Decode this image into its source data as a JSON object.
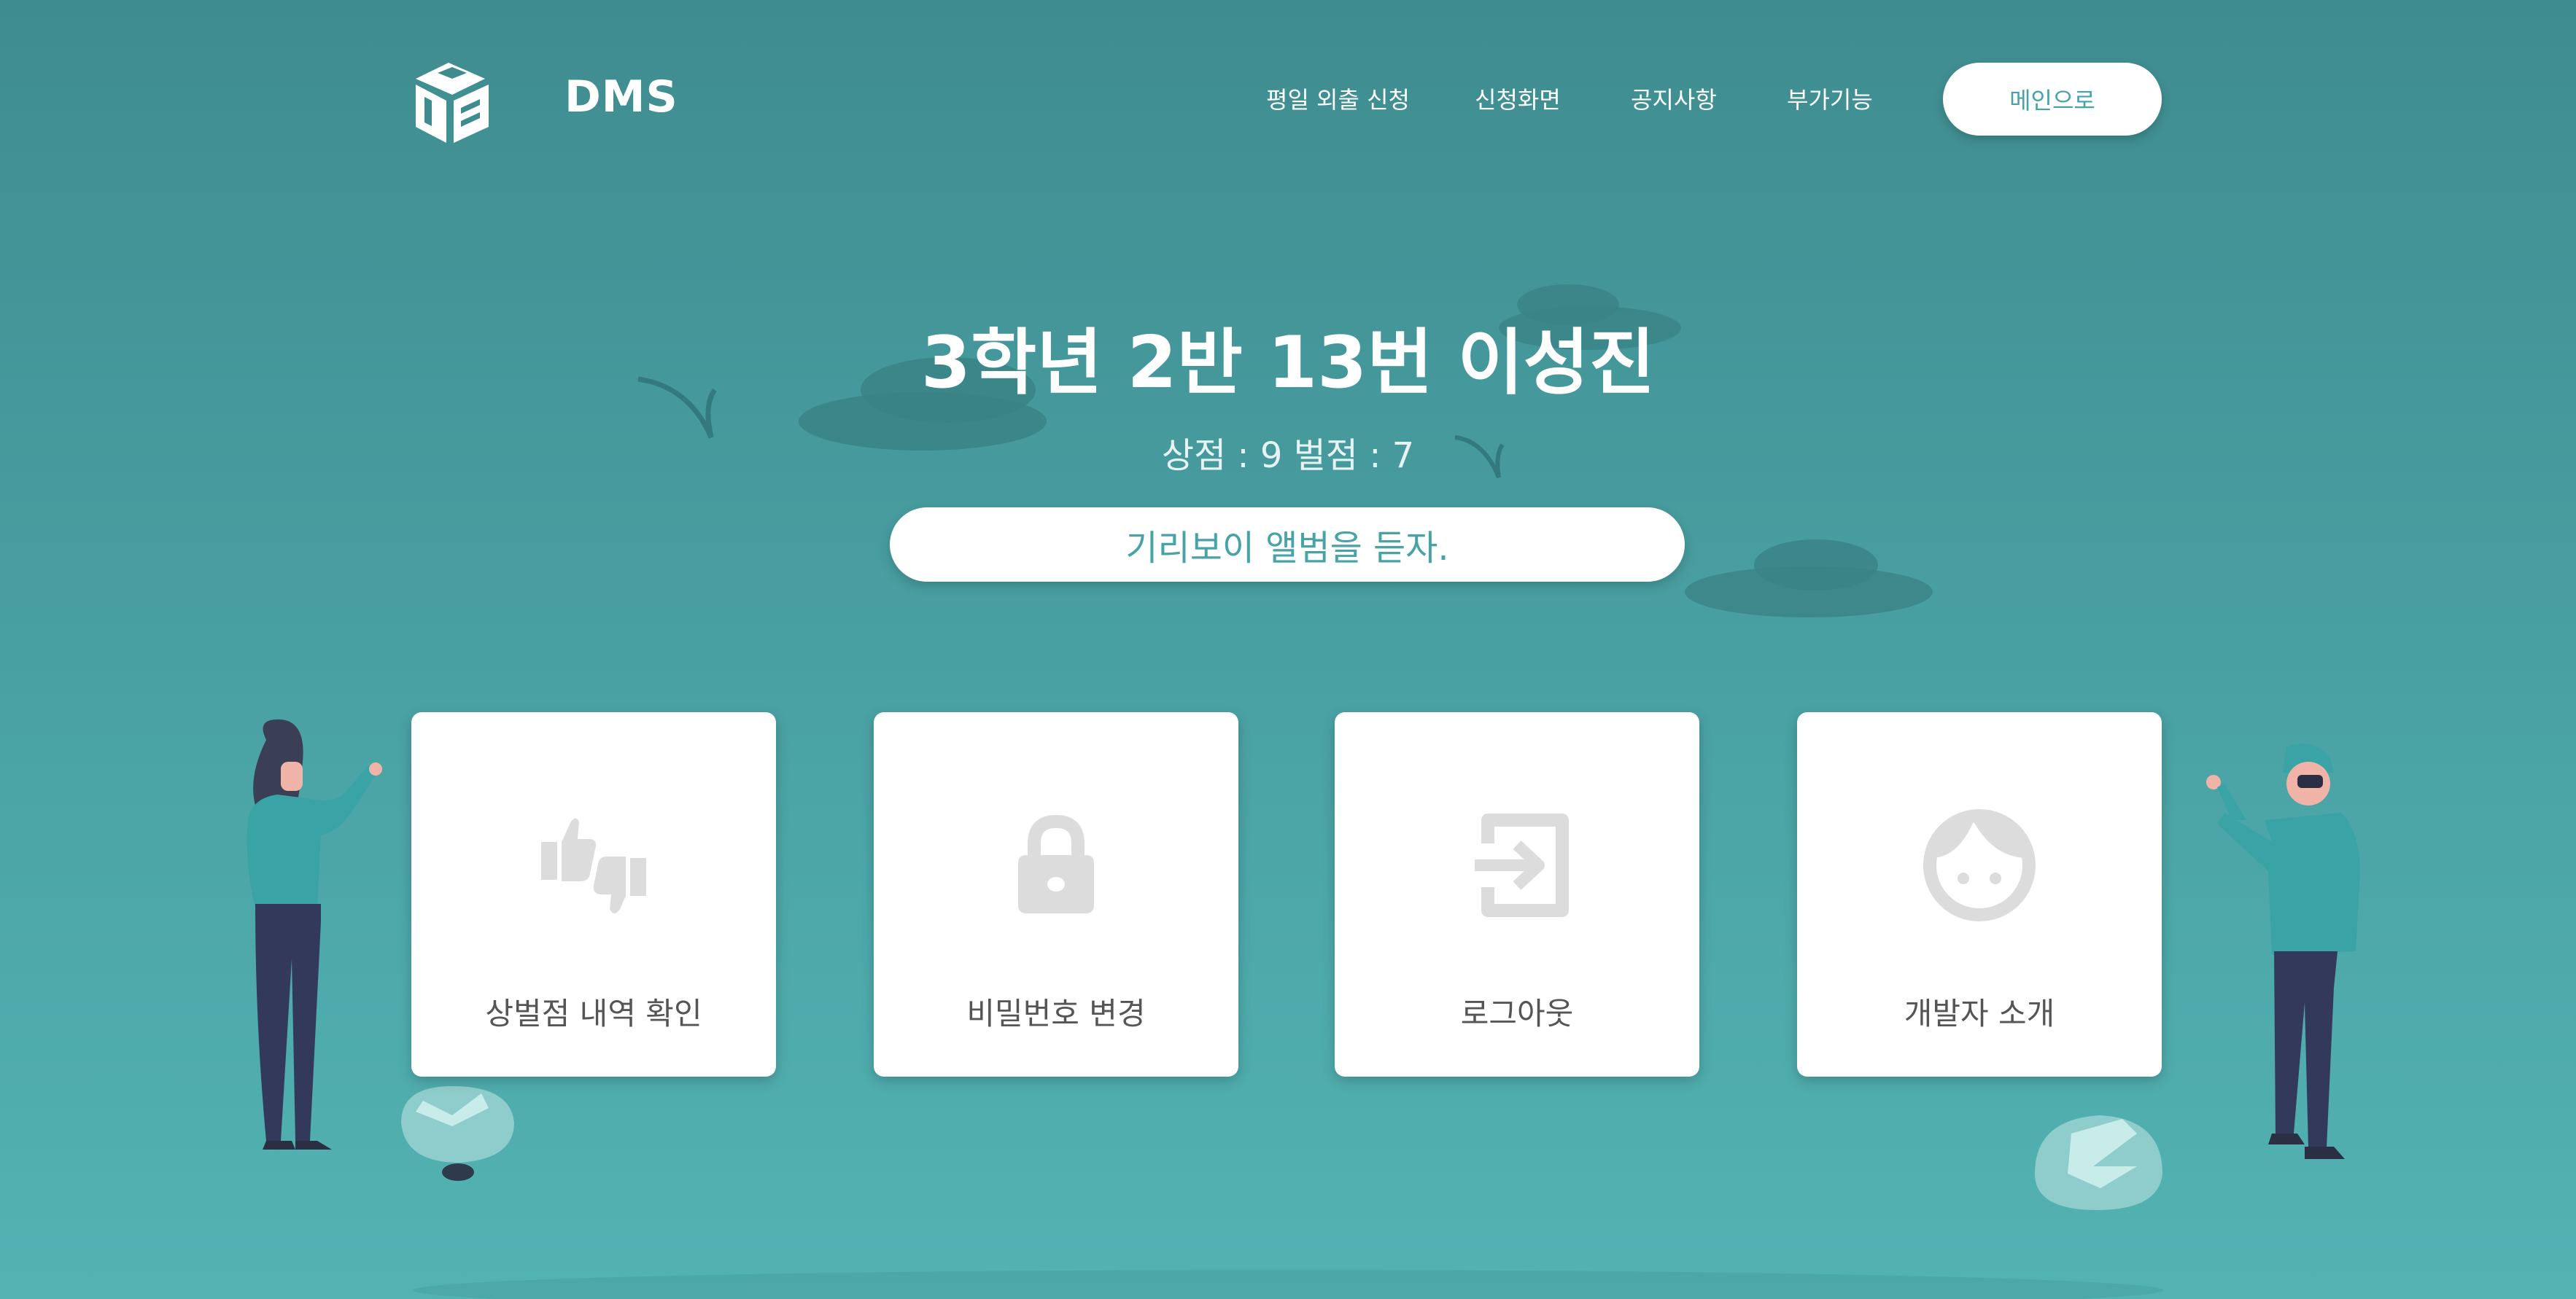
{
  "header": {
    "brand": "DMS",
    "nav": [
      {
        "label": "평일 외출 신청"
      },
      {
        "label": "신청화면"
      },
      {
        "label": "공지사항"
      },
      {
        "label": "부가기능"
      }
    ],
    "main_button": "메인으로"
  },
  "hero": {
    "student": "3학년 2반 13번 이성진",
    "points": "상점 : 9 벌점 : 7",
    "message": "기리보이 앨범을 듣자."
  },
  "cards": [
    {
      "label": "상벌점 내역 확인",
      "icon": "thumbs-up-down-icon"
    },
    {
      "label": "비밀번호 변경",
      "icon": "lock-icon"
    },
    {
      "label": "로그아웃",
      "icon": "logout-icon"
    },
    {
      "label": "개발자 소개",
      "icon": "face-icon"
    }
  ],
  "colors": {
    "accent": "#47a3a5",
    "background_top": "#3f8c90",
    "background_bottom": "#53b3b3",
    "icon_gray": "#dcdcdc"
  }
}
